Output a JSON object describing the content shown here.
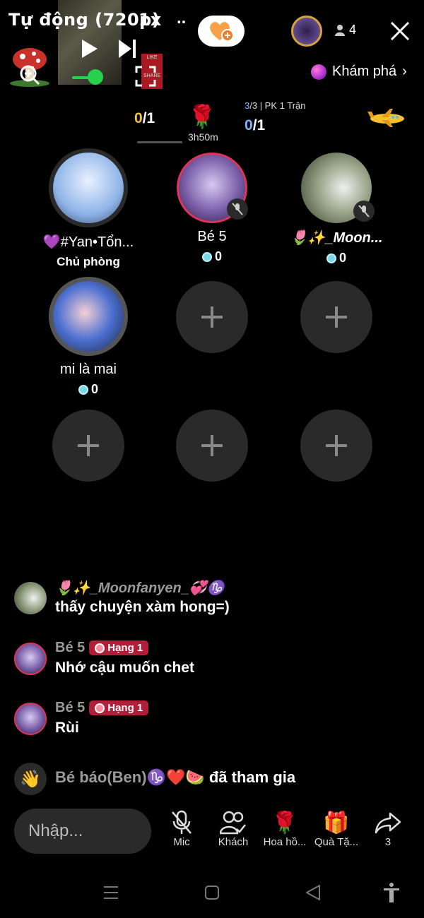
{
  "topbar": {
    "quality": "Tự động (720p)",
    "speed": "1x",
    "more": "..",
    "viewer_count": "4",
    "explore_label": "Khám phá",
    "like_label": "LIKE",
    "share_label": "SHARE"
  },
  "pk": {
    "left_score_hi": "0",
    "left_score_rest": "/1",
    "timer": "3h50m",
    "right_info_hi": "3",
    "right_info_rest": "/3 | PK 1 Trận",
    "right_score_hi": "0",
    "right_score_rest": "/1"
  },
  "seats": [
    {
      "name": "💜#Yan•Tổn...",
      "sub": "Chủ phòng"
    },
    {
      "name": "Bé 5",
      "sub": "0"
    },
    {
      "name": "🌷✨_Moon...",
      "sub": "0"
    },
    {
      "name": "mi là mai",
      "sub": "0"
    }
  ],
  "chat": [
    {
      "name": "🌷✨_Moonfanyen_💞♑",
      "text": "thấy chuyện xàm hong=)"
    },
    {
      "name": "Bé 5",
      "badge": "Hạng 1",
      "text": "Nhớ cậu muốn chet"
    },
    {
      "name": "Bé 5",
      "badge": "Hạng 1",
      "text": "Rùi"
    },
    {
      "name": "Bé báo(Ben)♑❤️🍉",
      "text": "đã tham gia"
    }
  ],
  "bottom": {
    "input_placeholder": "Nhập...",
    "mic": "Mic",
    "guests": "Khách",
    "rose": "Hoa hồ...",
    "gift": "Quà Tặ...",
    "share_count": "3"
  },
  "colors": {
    "accent_green": "#27d14e",
    "gold": "#f5c04a",
    "blue": "#7fb6ff",
    "badge_red": "#b01e38"
  }
}
